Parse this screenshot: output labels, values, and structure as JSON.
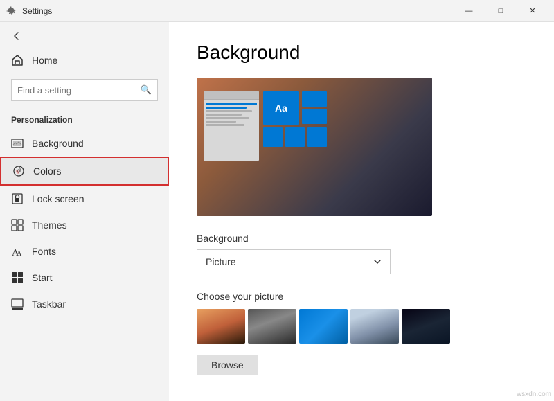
{
  "titleBar": {
    "title": "Settings",
    "minimizeLabel": "—",
    "maximizeLabel": "□",
    "closeLabel": "✕"
  },
  "sidebar": {
    "backLabel": "←",
    "homeLabel": "Home",
    "searchPlaceholder": "Find a setting",
    "sectionLabel": "Personalization",
    "navItems": [
      {
        "id": "background",
        "label": "Background",
        "active": false
      },
      {
        "id": "colors",
        "label": "Colors",
        "active": true
      },
      {
        "id": "lock-screen",
        "label": "Lock screen",
        "active": false
      },
      {
        "id": "themes",
        "label": "Themes",
        "active": false
      },
      {
        "id": "fonts",
        "label": "Fonts",
        "active": false
      },
      {
        "id": "start",
        "label": "Start",
        "active": false
      },
      {
        "id": "taskbar",
        "label": "Taskbar",
        "active": false
      }
    ]
  },
  "main": {
    "title": "Background",
    "backgroundLabel": "Background",
    "dropdownValue": "Picture",
    "choosePictureLabel": "Choose your picture",
    "browseLabel": "Browse",
    "previewAa": "Aa"
  },
  "watermark": "wsxdn.com"
}
